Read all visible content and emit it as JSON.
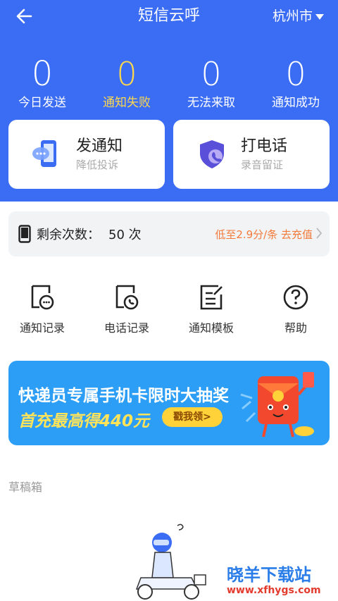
{
  "header": {
    "title": "短信云呼",
    "city": "杭州市"
  },
  "stats": [
    {
      "value": "0",
      "label": "今日发送"
    },
    {
      "value": "0",
      "label": "通知失败"
    },
    {
      "value": "0",
      "label": "无法来取"
    },
    {
      "value": "0",
      "label": "通知成功"
    }
  ],
  "cards": {
    "notify": {
      "title": "发通知",
      "subtitle": "降低投诉"
    },
    "call": {
      "title": "打电话",
      "subtitle": "录音留证"
    }
  },
  "remaining": {
    "label": "剩余次数：",
    "count": "50 次",
    "promo": "低至2.9分/条 去充值"
  },
  "grid": [
    {
      "label": "通知记录",
      "icon": "message-record-icon"
    },
    {
      "label": "电话记录",
      "icon": "call-record-icon"
    },
    {
      "label": "通知模板",
      "icon": "template-icon"
    },
    {
      "label": "帮助",
      "icon": "help-icon"
    }
  ],
  "banner": {
    "line1": "快递员专属手机卡限时大抽奖",
    "line2": "首充最高得440元",
    "button": "戳我领>"
  },
  "drafts": {
    "title": "草稿箱"
  },
  "watermark": {
    "line1": "晓羊下载站",
    "line2": "www.xfhygs.com"
  },
  "colors": {
    "primary": "#3a6cf4",
    "warning": "#ffd84d",
    "promo": "#f37a3b"
  }
}
